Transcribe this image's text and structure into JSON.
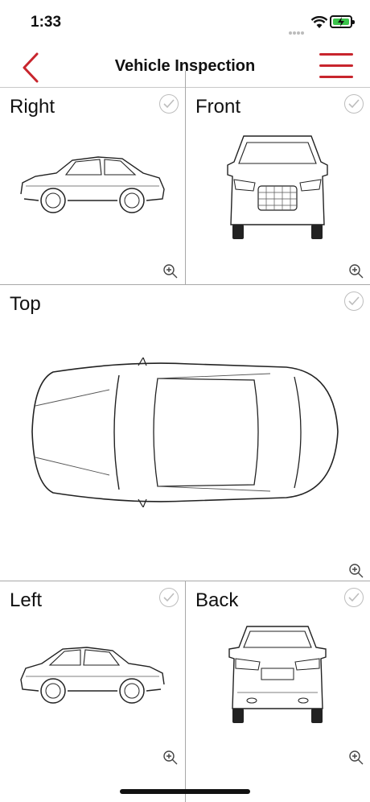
{
  "status_bar": {
    "time": "1:33"
  },
  "nav": {
    "title": "Vehicle Inspection"
  },
  "views": [
    {
      "label": "Right"
    },
    {
      "label": "Front"
    },
    {
      "label": "Top"
    },
    {
      "label": "Left"
    },
    {
      "label": "Back"
    }
  ],
  "colors": {
    "accent": "#c8252d",
    "battery": "#3ac34a",
    "divider": "#a8a8a8",
    "check": "#bdbdbd"
  },
  "icons": {
    "back": "chevron-left-icon",
    "menu": "hamburger-menu-icon",
    "check": "check-circle-icon",
    "zoom": "zoom-in-icon"
  }
}
